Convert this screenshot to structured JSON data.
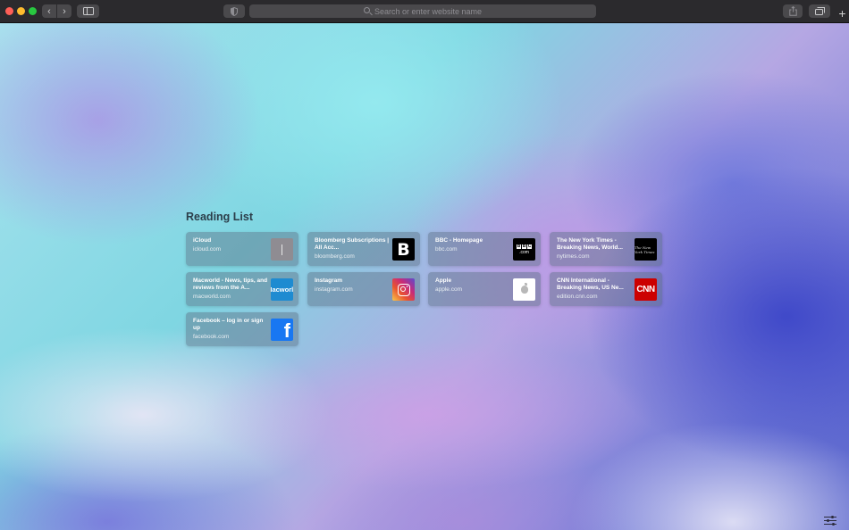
{
  "toolbar": {
    "address_placeholder": "Search or enter website name",
    "new_tab_label": "+"
  },
  "reading_list": {
    "title": "Reading List",
    "items": [
      {
        "title": "iCloud",
        "url": "icloud.com",
        "thumb": "icloud"
      },
      {
        "title": "Bloomberg Subscriptions | All Acc...",
        "url": "bloomberg.com",
        "thumb": "bloomberg",
        "thumb_text": "B"
      },
      {
        "title": "BBC - Homepage",
        "url": "bbc.com",
        "thumb": "bbc",
        "thumb_text": ".com"
      },
      {
        "title": "The New York Times - Breaking News, World...",
        "url": "nytimes.com",
        "thumb": "nyt",
        "thumb_text": "The New York Times"
      },
      {
        "title": "Macworld - News, tips, and reviews from the A...",
        "url": "macworld.com",
        "thumb": "macworld",
        "thumb_text": "Macworld"
      },
      {
        "title": "Instagram",
        "url": "instagram.com",
        "thumb": "instagram"
      },
      {
        "title": "Apple",
        "url": "apple.com",
        "thumb": "apple"
      },
      {
        "title": "CNN International - Breaking News, US Ne...",
        "url": "edition.cnn.com",
        "thumb": "cnn",
        "thumb_text": "CNN"
      },
      {
        "title": "Facebook – log in or sign up",
        "url": "facebook.com",
        "thumb": "facebook",
        "thumb_text": "f"
      }
    ]
  },
  "colors": {
    "toolbar_bg": "#2b2a2d",
    "close": "#ff5f57",
    "minimize": "#febc2e",
    "maximize": "#28c840"
  }
}
